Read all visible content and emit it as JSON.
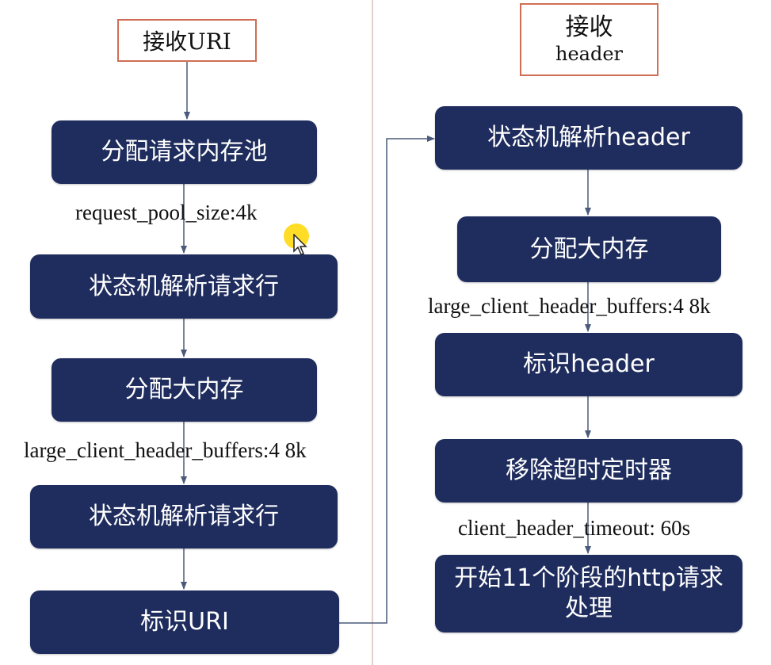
{
  "left_column": {
    "header": "接收URI",
    "steps": [
      "分配请求内存池",
      "状态机解析请求行",
      "分配大内存",
      "状态机解析请求行",
      "标识URI"
    ],
    "notes": [
      "request_pool_size:4k",
      "large_client_header_buffers:4 8k"
    ]
  },
  "right_column": {
    "header_line1": "接收",
    "header_line2": "header",
    "steps": [
      "状态机解析header",
      "分配大内存",
      "标识header",
      "移除超时定时器",
      "开始11个阶段的http请求处理"
    ],
    "notes": [
      "large_client_header_buffers:4 8k",
      "client_header_timeout: 60s"
    ]
  },
  "colors": {
    "node": "#1f2d5e",
    "header_border": "#cf6e55",
    "arrow": "#4a5a7a",
    "divider": "#e0d0cc"
  }
}
